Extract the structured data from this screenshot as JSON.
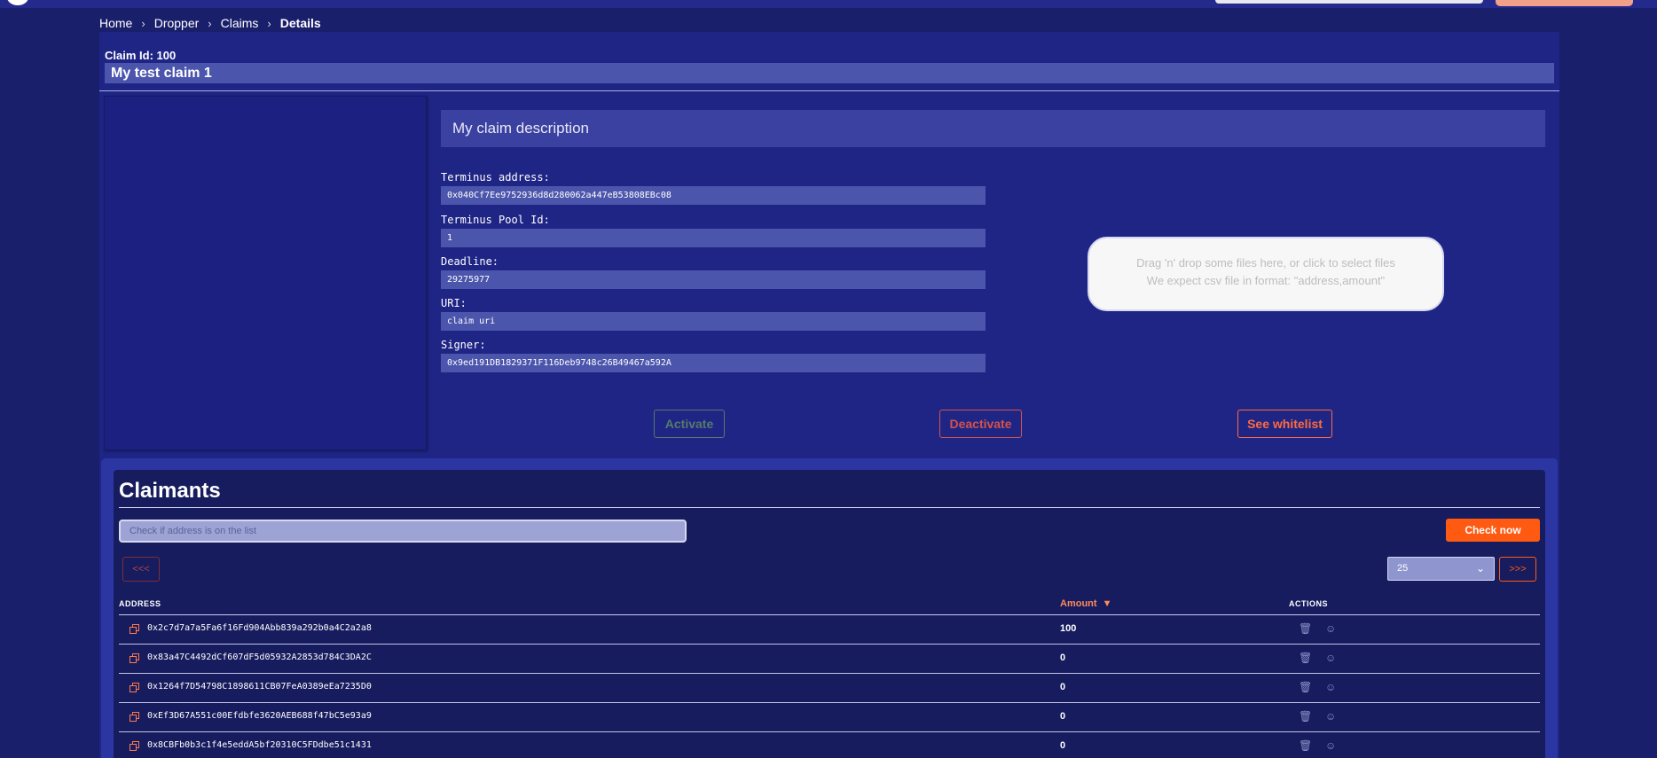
{
  "breadcrumb": {
    "items": [
      "Home",
      "Dropper",
      "Claims"
    ],
    "current": "Details",
    "separator": "›"
  },
  "claim": {
    "id_label": "Claim Id: 100",
    "title": "My test claim 1",
    "description": "My claim description",
    "fields": [
      {
        "label": "Terminus address:",
        "value": "0x040Cf7Ee9752936d8d280062a447eB53808EBc08"
      },
      {
        "label": "Terminus Pool Id:",
        "value": "1"
      },
      {
        "label": "Deadline:",
        "value": "29275977"
      },
      {
        "label": "URI:",
        "value": "claim uri"
      },
      {
        "label": "Signer:",
        "value": "0x9ed191DB1829371F116Deb9748c26B49467a592A"
      }
    ]
  },
  "dropzone": {
    "line1": "Drag 'n' drop some files here, or click to select files",
    "line2": "We expect csv file in format: \"address,amount\""
  },
  "actions": {
    "activate": "Activate",
    "deactivate": "Deactivate",
    "whitelist": "See whitelist"
  },
  "claimants": {
    "title": "Claimants",
    "search_placeholder": "Check if address is on the list",
    "check_button": "Check now",
    "prev_label": "<<<",
    "next_label": ">>>",
    "page_size": "25",
    "columns": {
      "address": "ADDRESS",
      "amount": "Amount",
      "actions": "ACTIONS"
    },
    "rows": [
      {
        "address": "0x2c7d7a7a5Fa6f16Fd904Abb839a292b0a4C2a2a8",
        "amount": "100"
      },
      {
        "address": "0x83a47C4492dCf607dF5d05932A2853d784C3DA2C",
        "amount": "0"
      },
      {
        "address": "0x1264f7D54798C1898611CB07FeA0389eEa7235D0",
        "amount": "0"
      },
      {
        "address": "0xEf3D67A551c00Efdbfe3620AEB688f47bC5e93a9",
        "amount": "0"
      },
      {
        "address": "0x8CBFb0b3c1f4e5eddA5bf20310C5FDdbe51c1431",
        "amount": "0"
      }
    ]
  },
  "colors": {
    "background": "#1a1f6b",
    "accent": "#ff5a12",
    "field_bg": "#4b55ac"
  }
}
